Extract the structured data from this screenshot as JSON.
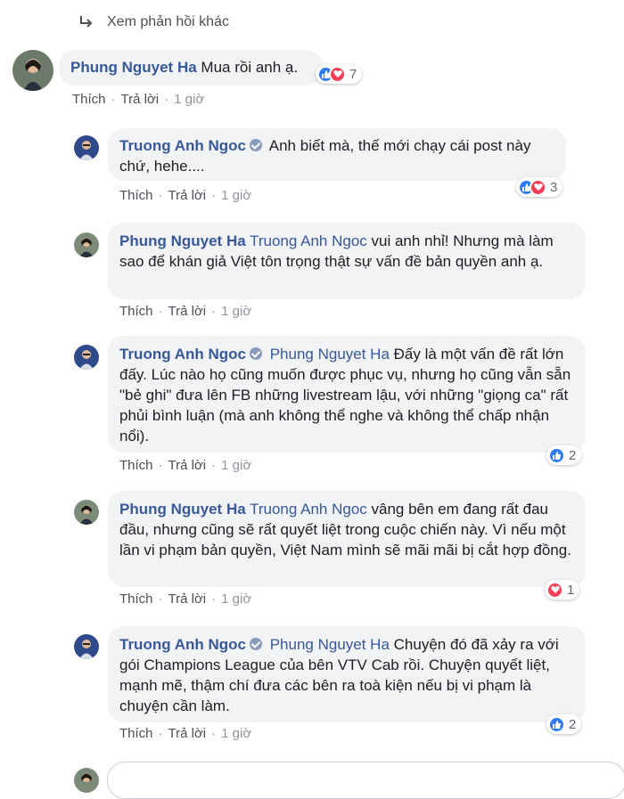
{
  "more_replies": "Xem phản hồi khác",
  "actions": {
    "like": "Thích",
    "reply": "Trả lời",
    "sep": "·"
  },
  "comments": [
    {
      "author": "Phung Nguyet Ha",
      "tag": "",
      "text": "Mua rồi anh ạ.",
      "time": "1 giờ",
      "reaction_count": "7",
      "reactions": [
        "like",
        "love"
      ],
      "verified": false,
      "avatar": "female"
    },
    {
      "author": "Truong Anh Ngoc",
      "tag": "",
      "text": "Anh biết mà, thế mới chạy cái post này chứ, hehe....",
      "time": "1 giờ",
      "reaction_count": "3",
      "reactions": [
        "like",
        "love"
      ],
      "verified": true,
      "avatar": "male"
    },
    {
      "author": "Phung Nguyet Ha",
      "tag": "Truong Anh Ngoc",
      "text": "vui anh nhỉ! Nhưng mà làm sao để khán giả Việt tôn trọng thật sự vấn đề bản quyền anh ạ.",
      "time": "1 giờ",
      "reaction_count": "",
      "reactions": [],
      "verified": false,
      "avatar": "female"
    },
    {
      "author": "Truong Anh Ngoc",
      "tag": "Phung Nguyet Ha",
      "text": "Đấy là một vấn đề rất lớn đấy. Lúc nào họ cũng muốn được phục vụ, nhưng họ cũng vẫn sẵn \"bẻ ghi\" đưa lên FB những livestream lậu, với những \"giọng ca\" rất phủi bình luận (mà anh không thể nghe và không thể chấp nhận nổi).",
      "time": "1 giờ",
      "reaction_count": "2",
      "reactions": [
        "like"
      ],
      "verified": true,
      "avatar": "male"
    },
    {
      "author": "Phung Nguyet Ha",
      "tag": "Truong Anh Ngoc",
      "text": "vâng bên em đang rất đau đầu, nhưng cũng sẽ rất quyết liệt trong cuộc chiến này. Vì nếu một lần vi phạm bản quyền, Việt Nam mình sẽ mãi mãi bị cắt hợp đồng.",
      "time": "1 giờ",
      "reaction_count": "1",
      "reactions": [
        "love"
      ],
      "verified": false,
      "avatar": "female"
    },
    {
      "author": "Truong Anh Ngoc",
      "tag": "Phung Nguyet Ha",
      "text": "Chuyện đó đã xảy ra với gói Champions League của bên VTV Cab rồi. Chuyện quyết liệt, mạnh mẽ, thậm chí đưa các bên ra toà kiện nếu bị vi phạm là chuyện cần làm.",
      "time": "1 giờ",
      "reaction_count": "2",
      "reactions": [
        "like"
      ],
      "verified": true,
      "avatar": "male"
    }
  ],
  "colors": {
    "link": "#385898",
    "bubble": "#f2f3f5",
    "like": "#2e7bf2",
    "love": "#f33e58"
  },
  "icons": {
    "reply_arrow": "reply-arrow-icon",
    "verified": "verified-badge-icon",
    "like": "like-reaction-icon",
    "love": "love-reaction-icon"
  }
}
